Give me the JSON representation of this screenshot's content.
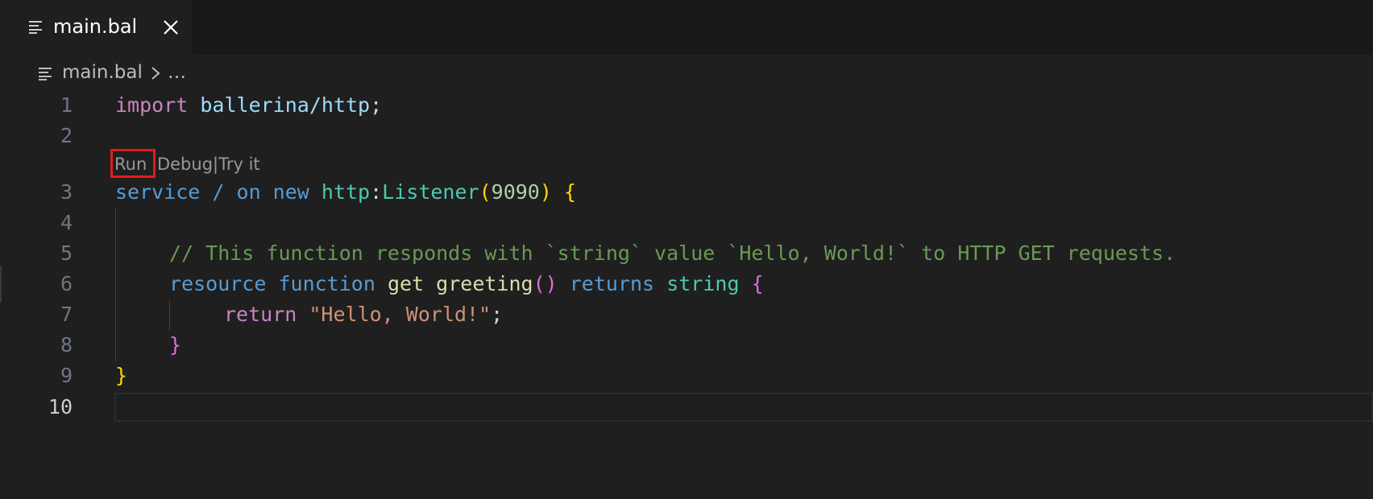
{
  "tab": {
    "label": "main.bal",
    "icon": "file-lines-icon",
    "close_icon": "close-icon"
  },
  "breadcrumb": {
    "file": "main.bal",
    "separator_icon": "chevron-right-icon",
    "more": "…"
  },
  "codelens": {
    "run": "Run",
    "debug": "Debug",
    "sep": "|",
    "tryit": "Try it"
  },
  "line_numbers": [
    "1",
    "2",
    "3",
    "4",
    "5",
    "6",
    "7",
    "8",
    "9",
    "10"
  ],
  "code": {
    "l1": {
      "kw": "import",
      "sp": " ",
      "mod": "ballerina/http",
      "semi": ";"
    },
    "l3": {
      "kw1": "service",
      "slash": " / ",
      "kw2": "on",
      "kw3": " new ",
      "mod": "http",
      "colon": ":",
      "type": "Listener",
      "lp": "(",
      "num": "9090",
      "rp": ")",
      "sp": " ",
      "lb": "{"
    },
    "l5": {
      "comment": "// This function responds with `string` value `Hello, World!` to HTTP GET requests."
    },
    "l6": {
      "kw1": "resource",
      "kw2": " function",
      "sp": " ",
      "get": "get",
      "sp2": " ",
      "fn": "greeting",
      "parens": "()",
      "kw3": " returns",
      "sp3": " ",
      "type": "string",
      "sp4": " ",
      "lb": "{"
    },
    "l7": {
      "kw": "return",
      "sp": " ",
      "str": "\"Hello, World!\"",
      "semi": ";"
    },
    "l8": {
      "rb": "}"
    },
    "l9": {
      "rb": "}"
    }
  },
  "colors": {
    "background": "#1f1f1f",
    "highlight_box": "#e21a1a"
  }
}
